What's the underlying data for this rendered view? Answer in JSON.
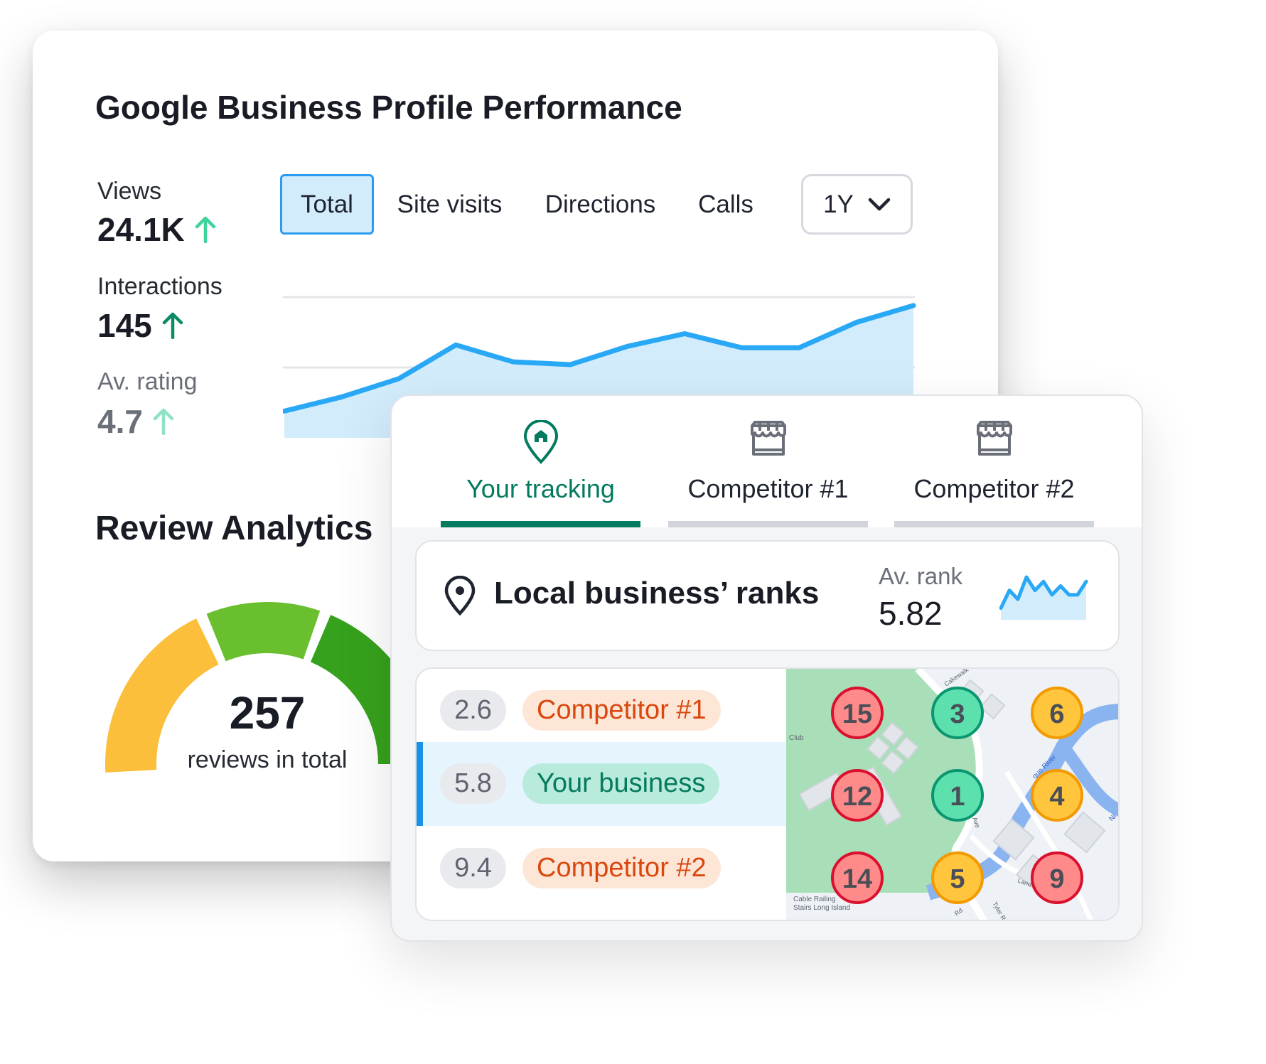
{
  "performance": {
    "title": "Google Business Profile Performance",
    "metrics": [
      {
        "label": "Views",
        "value": "24.1K",
        "trend": "up",
        "color": "#3dd39a"
      },
      {
        "label": "Interactions",
        "value": "145",
        "trend": "up",
        "color": "#0a8a66"
      },
      {
        "label": "Av. rating",
        "value": "4.7",
        "trend": "up",
        "color": "#8fe3c4"
      }
    ],
    "tabs": [
      {
        "label": "Total",
        "active": true
      },
      {
        "label": "Site visits"
      },
      {
        "label": "Directions"
      },
      {
        "label": "Calls"
      }
    ],
    "period": {
      "value": "1Y",
      "icon": "chevron-down-icon"
    }
  },
  "chart_data": {
    "type": "area",
    "values": [
      19,
      29,
      42,
      66,
      54,
      52,
      65,
      74,
      64,
      64,
      82,
      94
    ],
    "ylim": [
      0,
      100
    ],
    "grid": true,
    "color": "#29a8f5",
    "fill": "#d2ecfc"
  },
  "reviews": {
    "title": "Review Analytics",
    "total": "257",
    "caption": "reviews in total",
    "gauge_colors": [
      "#fbbf3c",
      "#6abf2e",
      "#36a11c"
    ]
  },
  "tracking": {
    "tabs": [
      {
        "label": "Your tracking",
        "icon": "location-home-icon",
        "active": true
      },
      {
        "label": "Competitor #1",
        "icon": "storefront-icon"
      },
      {
        "label": "Competitor #2",
        "icon": "storefront-icon"
      }
    ],
    "ranks": {
      "title": "Local business’ ranks",
      "av_label": "Av. rank",
      "av_value": "5.82",
      "sparkline": [
        2,
        6,
        4,
        9,
        6,
        8,
        5,
        7,
        5,
        5,
        8
      ]
    },
    "list": [
      {
        "rank": "2.6",
        "name": "Competitor #1",
        "type": "competitor"
      },
      {
        "rank": "5.8",
        "name": "Your business",
        "type": "you"
      },
      {
        "rank": "9.4",
        "name": "Competitor #2",
        "type": "competitor"
      }
    ],
    "map": {
      "labels": [
        "Club",
        "Cable Railing",
        "Stairs Long Island",
        "Cakewalk",
        "Ave",
        "que River",
        "Ni",
        "Land",
        "Tyler Rd",
        "Rd"
      ],
      "grid": [
        [
          "15",
          "3",
          "6"
        ],
        [
          "12",
          "1",
          "4"
        ],
        [
          "14",
          "5",
          "9"
        ]
      ],
      "levels": [
        [
          "red",
          "green",
          "yellow"
        ],
        [
          "red",
          "green",
          "yellow"
        ],
        [
          "red",
          "yellow",
          "red"
        ]
      ]
    }
  }
}
